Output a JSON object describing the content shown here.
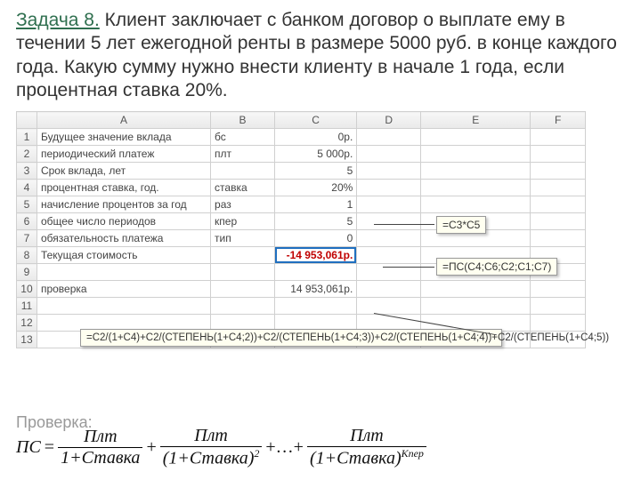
{
  "title": {
    "lead": "Задача 8.",
    "body": " Клиент заключает с банком договор о выплате ему в течении 5 лет ежегодной ренты в размере 5000 руб. в конце каждого года. Какую сумму нужно внести клиенту в начале 1 года, если процентная ставка 20%."
  },
  "spreadsheet": {
    "columns": [
      "",
      "A",
      "B",
      "C",
      "D",
      "E",
      "F"
    ],
    "rows": [
      {
        "n": "1",
        "A": "Будущее значение вклада",
        "B": "бс",
        "C": "0р."
      },
      {
        "n": "2",
        "A": "периодический платеж",
        "B": "плт",
        "C": "5 000р."
      },
      {
        "n": "3",
        "A": "Срок вклада, лет",
        "B": "",
        "C": "5"
      },
      {
        "n": "4",
        "A": "процентная ставка, год.",
        "B": "ставка",
        "C": "20%"
      },
      {
        "n": "5",
        "A": "начисление процентов за год",
        "B": "раз",
        "C": "1"
      },
      {
        "n": "6",
        "A": "общее число периодов",
        "B": "кпер",
        "C": "5"
      },
      {
        "n": "7",
        "A": "обязательность платежа",
        "B": "тип",
        "C": "0"
      },
      {
        "n": "8",
        "A": "Текущая стоимость",
        "B": "",
        "C": "-14 953,061р."
      },
      {
        "n": "9",
        "A": "",
        "B": "",
        "C": ""
      },
      {
        "n": "10",
        "A": "проверка",
        "B": "",
        "C": "14 953,061р."
      },
      {
        "n": "11",
        "A": "",
        "B": "",
        "C": ""
      },
      {
        "n": "12",
        "A": "",
        "B": "",
        "C": ""
      },
      {
        "n": "13",
        "A": "",
        "B": "",
        "C": ""
      }
    ]
  },
  "callouts": {
    "c5": "=C3*C5",
    "c7": "=ПС(C4;C6;C2;C1;C7)",
    "c10": "=C2/(1+C4)+C2/(СТЕПЕНЬ(1+C4;2))+C2/(СТЕПЕНЬ(1+C4;3))+C2/(СТЕПЕНЬ(1+C4;4))+C2/(СТЕПЕНЬ(1+C4;5))"
  },
  "proverka_label": "Проверка:",
  "formula": {
    "lhs": "ПС",
    "eq": "=",
    "t1_num": "Плт",
    "t1_den": "1+Ставка",
    "t2_num": "Плт",
    "t2_den": "(1+Ставка)",
    "t2_exp": "2",
    "dots": "+…+",
    "tn_num": "Плт",
    "tn_den": "(1+Ставка)",
    "tn_exp": "Кпер"
  }
}
